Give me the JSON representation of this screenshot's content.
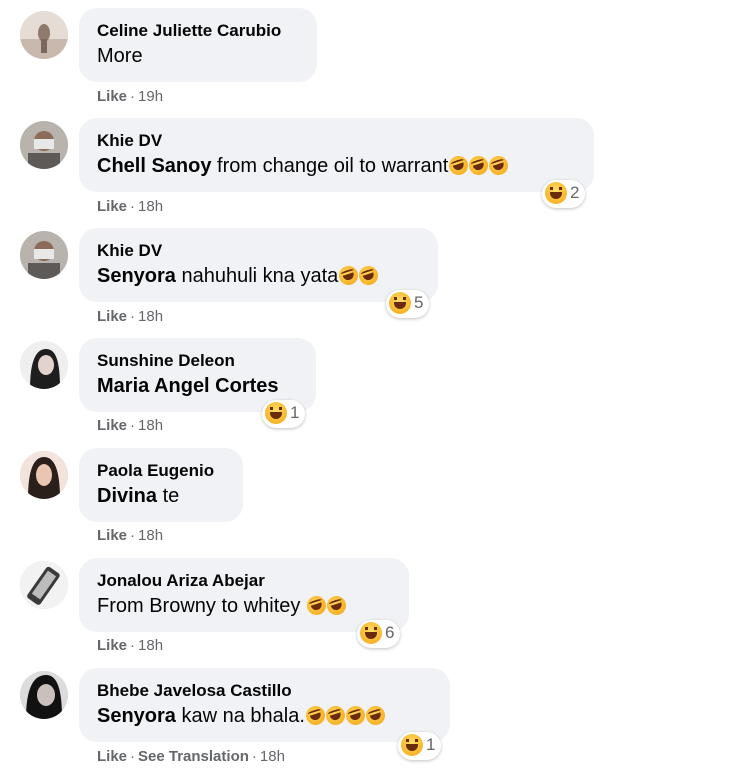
{
  "comments": [
    {
      "author": "Celine Juliette Carubio",
      "mention": "",
      "text": "More",
      "emoji_count": 0,
      "reaction_count": "",
      "like_label": "Like",
      "see_translation_label": "",
      "time": "19h"
    },
    {
      "author": "Khie DV",
      "mention": "Chell Sanoy",
      "text": " from change oil to warrant",
      "emoji_count": 3,
      "reaction_count": "2",
      "like_label": "Like",
      "see_translation_label": "",
      "time": "18h"
    },
    {
      "author": "Khie DV",
      "mention": "Senyora",
      "text": " nahuhuli kna yata",
      "emoji_count": 2,
      "reaction_count": "5",
      "like_label": "Like",
      "see_translation_label": "",
      "time": "18h"
    },
    {
      "author": "Sunshine Deleon",
      "mention": "Maria Angel Cortes",
      "text": "",
      "emoji_count": 0,
      "reaction_count": "1",
      "like_label": "Like",
      "see_translation_label": "",
      "time": "18h"
    },
    {
      "author": "Paola Eugenio",
      "mention": "Divina",
      "text": " te",
      "emoji_count": 0,
      "reaction_count": "",
      "like_label": "Like",
      "see_translation_label": "",
      "time": "18h"
    },
    {
      "author": "Jonalou Ariza Abejar",
      "mention": "",
      "text": "From Browny to whitey ",
      "emoji_count": 2,
      "reaction_count": "6",
      "like_label": "Like",
      "see_translation_label": "",
      "time": "18h"
    },
    {
      "author": "Bhebe Javelosa Castillo",
      "mention": "Senyora",
      "text": " kaw na bhala.",
      "emoji_count": 4,
      "reaction_count": "1",
      "like_label": "Like",
      "see_translation_label": "See Translation",
      "time": "18h"
    }
  ],
  "emoji_name": "rolling-on-floor-laughing-emoji",
  "reaction_icon_name": "haha-reaction-icon",
  "colors": {
    "bubble_bg": "#f0f2f5",
    "meta_text": "#65676b",
    "reaction_yellow": "#f7b125"
  }
}
